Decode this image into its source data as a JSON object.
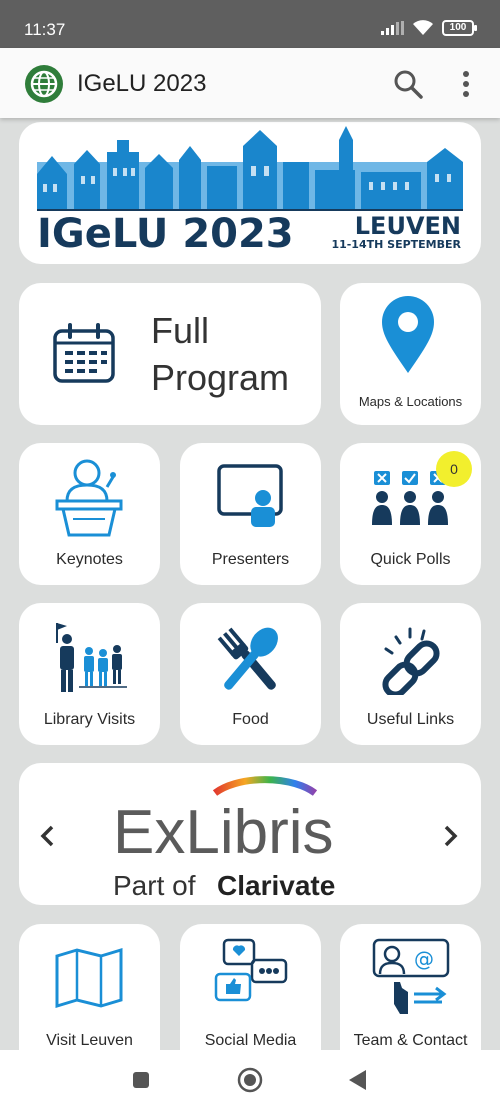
{
  "status_bar": {
    "time": "11:37",
    "battery": "100"
  },
  "app_bar": {
    "title": "IGeLU 2023"
  },
  "banner": {
    "title": "IGeLU 2023",
    "city": "LEUVEN",
    "dates": "11-14TH SEPTEMBER"
  },
  "tiles": {
    "full_program": {
      "line1": "Full",
      "line2": "Program"
    },
    "maps": "Maps & Locations",
    "keynotes": "Keynotes",
    "presenters": "Presenters",
    "quick_polls": {
      "label": "Quick Polls",
      "badge": "0"
    },
    "library_visits": "Library Visits",
    "food": "Food",
    "useful_links": "Useful Links",
    "visit_leuven": "Visit Leuven",
    "social_media": "Social Media",
    "team_contact": "Team & Contact"
  },
  "sponsor": {
    "brand": "ExLibris",
    "tagline_prefix": "Part of",
    "tagline_brand": "Clarivate"
  },
  "colors": {
    "accent_blue": "#1a8fd6",
    "navy": "#163a5c",
    "badge_yellow": "#f2ef2d"
  }
}
